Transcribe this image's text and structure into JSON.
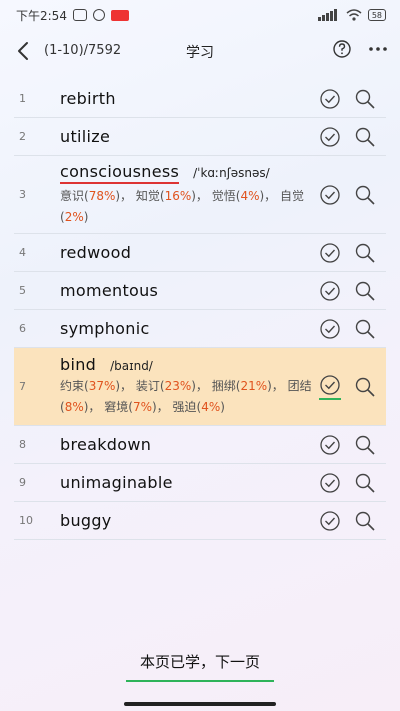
{
  "status_bar": {
    "time": "下午2:54",
    "battery": "58"
  },
  "header": {
    "counter": "(1-10)/7592",
    "title": "学习"
  },
  "words": [
    {
      "index": "1",
      "word": "rebirth"
    },
    {
      "index": "2",
      "word": "utilize"
    },
    {
      "index": "3",
      "word": "consciousness",
      "phonetic": "/ˈkɑːnʃəsnəs/",
      "senses": [
        {
          "text": "意识",
          "pct": "78%"
        },
        {
          "text": "知觉",
          "pct": "16%"
        },
        {
          "text": "觉悟",
          "pct": "4%"
        },
        {
          "text": "自觉",
          "pct": "2%"
        }
      ]
    },
    {
      "index": "4",
      "word": "redwood"
    },
    {
      "index": "5",
      "word": "momentous"
    },
    {
      "index": "6",
      "word": "symphonic"
    },
    {
      "index": "7",
      "word": "bind",
      "phonetic": "/baɪnd/",
      "senses": [
        {
          "text": "约束",
          "pct": "37%"
        },
        {
          "text": "装订",
          "pct": "23%"
        },
        {
          "text": "捆绑",
          "pct": "21%"
        },
        {
          "text": "团结",
          "pct": "8%"
        },
        {
          "text": "窘境",
          "pct": "7%"
        },
        {
          "text": "强迫",
          "pct": "4%"
        }
      ]
    },
    {
      "index": "8",
      "word": "breakdown"
    },
    {
      "index": "9",
      "word": "unimaginable"
    },
    {
      "index": "10",
      "word": "buggy"
    }
  ],
  "footer": {
    "button_label": "本页已学，下一页"
  },
  "colors": {
    "highlight": "#fbe3bd",
    "percent": "#e0531e",
    "underline_green": "#2eb35a",
    "underline_red": "#d33333"
  },
  "icons": [
    "back-icon",
    "help-icon",
    "more-icon",
    "check-circle-icon",
    "search-icon"
  ]
}
